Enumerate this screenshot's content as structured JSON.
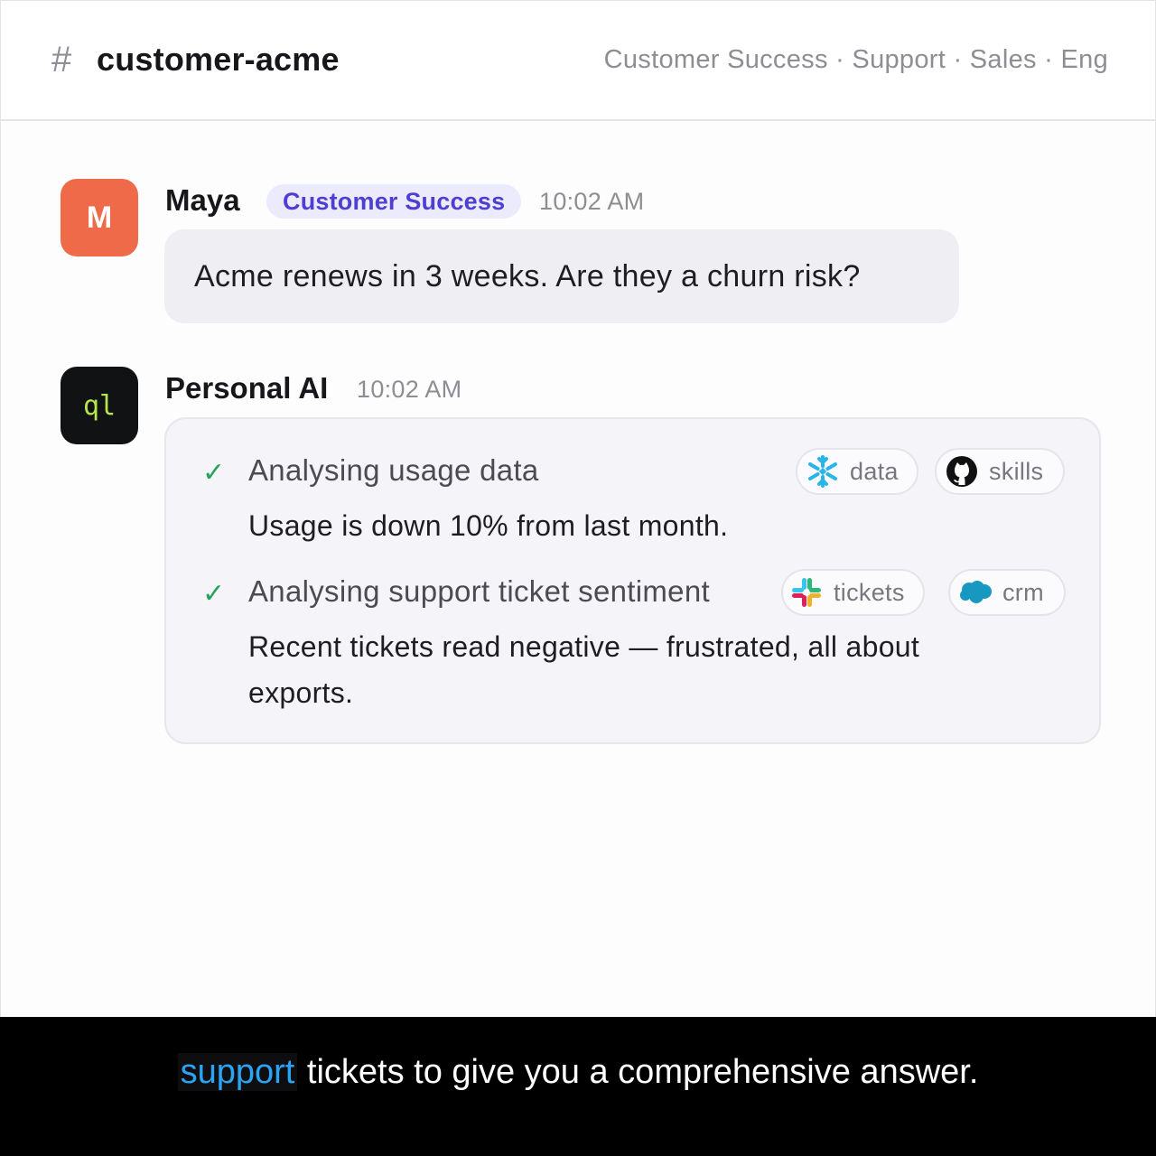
{
  "header": {
    "hash": "#",
    "channel": "customer-acme",
    "teams": "Customer Success · Support · Sales · Eng"
  },
  "messages": [
    {
      "avatar_initial": "M",
      "sender": "Maya",
      "badge": "Customer Success",
      "time": "10:02 AM",
      "text": "Acme renews in 3 weeks. Are they a churn risk?"
    },
    {
      "avatar_initial": "ql",
      "sender": "Personal AI",
      "time": "10:02 AM",
      "steps": [
        {
          "check": "✓",
          "title": "Analysing usage data",
          "result_line1": "Usage is down 10% from last month.",
          "result_line2": "",
          "sources": [
            {
              "label": "data",
              "icon": "snowflake-icon"
            },
            {
              "label": "skills",
              "icon": "github-icon"
            }
          ]
        },
        {
          "check": "✓",
          "title": "Analysing support ticket sentiment",
          "result_line1": "Recent tickets read negative — frustrated, all about",
          "result_line2": "exports.",
          "sources": [
            {
              "label": "tickets",
              "icon": "slack-icon"
            },
            {
              "label": "crm",
              "icon": "salesforce-icon"
            }
          ]
        }
      ]
    }
  ],
  "caption": {
    "highlight": "support",
    "rest": " tickets to give you a comprehensive answer."
  },
  "colors": {
    "maya_avatar": "#ee6a49",
    "ai_avatar": "#111214",
    "ai_avatar_text": "#b6e64c",
    "badge_bg": "#ecebfd",
    "badge_text": "#4f3fd1",
    "check": "#2aa35a",
    "caption_highlight": "#2aa4f4"
  }
}
